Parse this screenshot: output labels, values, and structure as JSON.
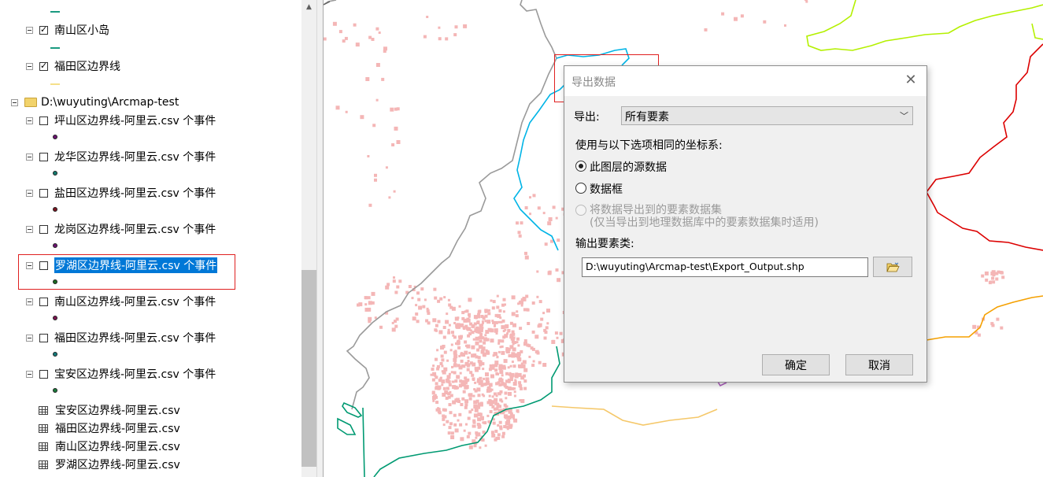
{
  "toc": {
    "items": [
      {
        "label": "南山区小岛",
        "checked": true
      },
      {
        "label": "福田区边界线",
        "checked": true
      }
    ],
    "folder_label": "D:\\wuyuting\\Arcmap-test",
    "csv_layers": [
      {
        "label": "坪山区边界线-阿里云.csv 个事件",
        "dot_color": "#6a1470"
      },
      {
        "label": "龙华区边界线-阿里云.csv 个事件",
        "dot_color": "#137a6e"
      },
      {
        "label": "盐田区边界线-阿里云.csv 个事件",
        "dot_color": "#7a1420"
      },
      {
        "label": "龙岗区边界线-阿里云.csv 个事件",
        "dot_color": "#6a1470"
      },
      {
        "label": "罗湖区边界线-阿里云.csv 个事件",
        "dot_color": "#1a6a20",
        "selected": true
      },
      {
        "label": "南山区边界线-阿里云.csv 个事件",
        "dot_color": "#7a1450"
      },
      {
        "label": "福田区边界线-阿里云.csv 个事件",
        "dot_color": "#137a7a"
      },
      {
        "label": "宝安区边界线-阿里云.csv 个事件",
        "dot_color": "#1a7a3a"
      }
    ],
    "tables": [
      {
        "label": "宝安区边界线-阿里云.csv"
      },
      {
        "label": "福田区边界线-阿里云.csv"
      },
      {
        "label": "南山区边界线-阿里云.csv"
      },
      {
        "label": "罗湖区边界线-阿里云.csv"
      }
    ]
  },
  "dialog": {
    "title": "导出数据",
    "export_label": "导出:",
    "export_value": "所有要素",
    "coord_label": "使用与以下选项相同的坐标系:",
    "option_source": "此图层的源数据",
    "option_frame": "数据框",
    "option_dataset_line1": "将数据导出到的要素数据集",
    "option_dataset_line2": "(仅当导出到地理数据库中的要素数据集时适用)",
    "output_label": "输出要素类:",
    "output_path": "D:\\wuyuting\\Arcmap-test\\Export_Output.shp",
    "ok_label": "确定",
    "cancel_label": "取消"
  },
  "colors": {
    "selection": "#0078d7",
    "highlight_red": "#e02020",
    "point_pink": "#f4b6b6",
    "boundary_cyan": "#00b4e6",
    "boundary_green": "#009a72",
    "boundary_gray": "#999999",
    "boundary_lime": "#b4f000",
    "boundary_red": "#dc0000",
    "boundary_orange": "#f5a000",
    "boundary_yellow": "#f5c86a"
  }
}
